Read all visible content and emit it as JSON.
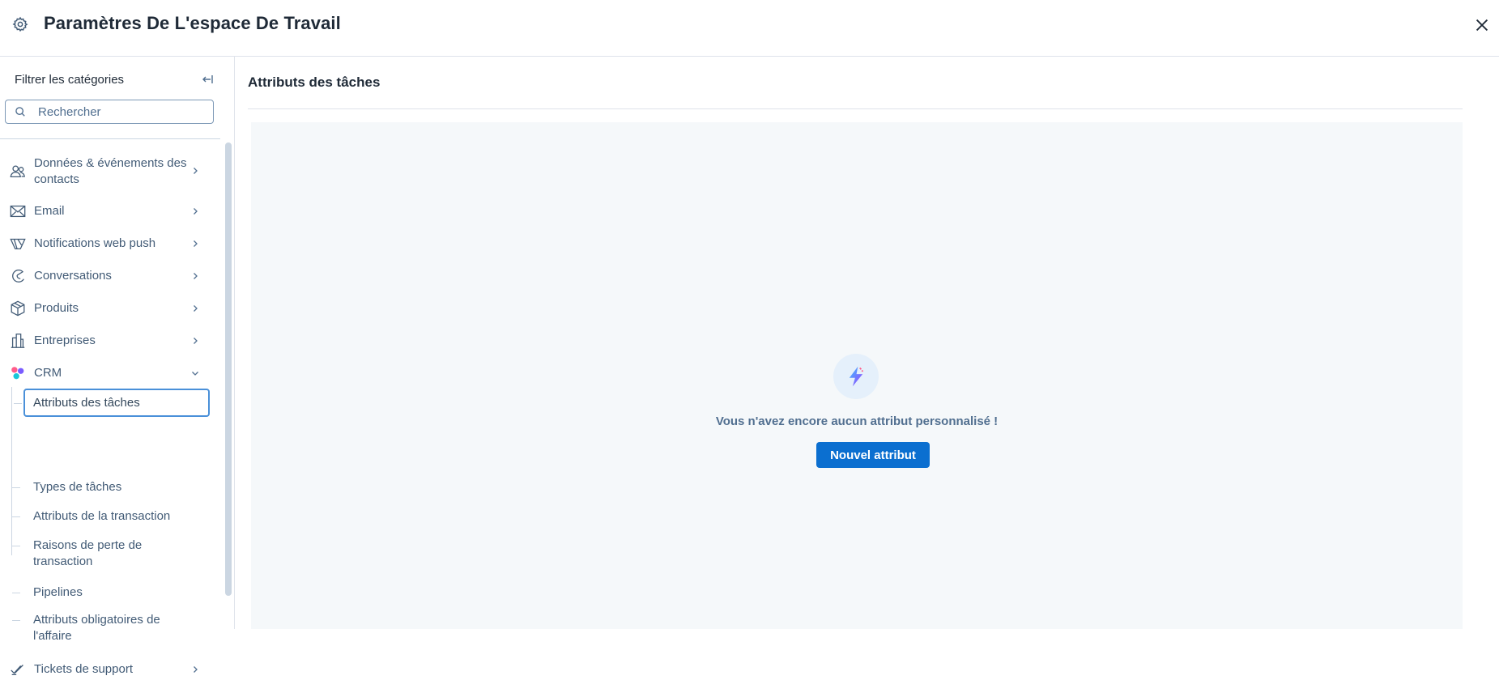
{
  "header": {
    "title": "Paramètres De L'espace De Travail",
    "icon": "gear-icon",
    "close_icon": "close-icon"
  },
  "sidebar": {
    "filter_label": "Filtrer les catégories",
    "search": {
      "placeholder": "Rechercher",
      "value": ""
    },
    "items": [
      {
        "label_lines": [
          "Données & événements des",
          "contacts"
        ],
        "icon": "contacts-icon"
      },
      {
        "label": "Email",
        "icon": "email-icon"
      },
      {
        "label": "Notifications web push",
        "icon": "web-push-icon"
      },
      {
        "label": "Conversations",
        "icon": "conversations-icon"
      },
      {
        "label": "Produits",
        "icon": "products-icon"
      },
      {
        "label": "Entreprises",
        "icon": "companies-icon"
      },
      {
        "label": "CRM",
        "icon": "crm-icon",
        "expanded": true
      },
      {
        "label": "Tickets de support",
        "icon": "tickets-icon"
      }
    ],
    "crm_children": [
      {
        "label": "Attributs des tâches",
        "active": true
      },
      {
        "label": "Types de tâches"
      },
      {
        "label": "Attributs de la transaction"
      },
      {
        "label_lines": [
          "Raisons de perte de",
          "transaction"
        ]
      },
      {
        "label": "Pipelines"
      },
      {
        "label_lines": [
          "Attributs obligatoires de",
          "l'affaire"
        ]
      }
    ]
  },
  "main": {
    "title": "Attributs des tâches",
    "empty_state": {
      "message": "Vous n'avez encore aucun attribut personnalisé !",
      "button_label": "Nouvel attribut"
    }
  },
  "colors": {
    "primary_button": "#0b6fd0",
    "active_border": "#4a90d9",
    "panel_bg": "#f5f8fa"
  }
}
